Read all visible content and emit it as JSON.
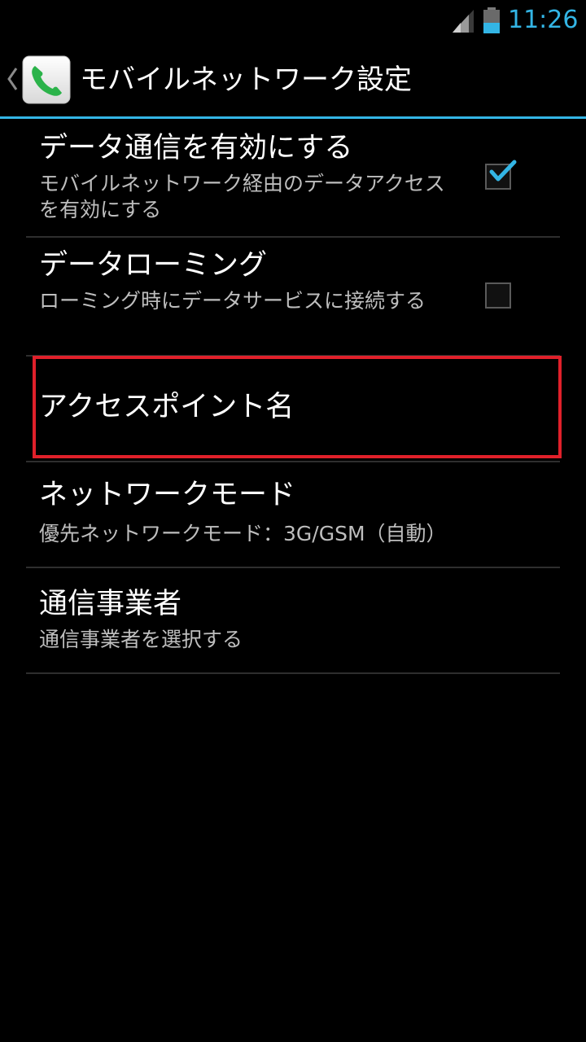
{
  "status_bar": {
    "time": "11:26",
    "signal_icon": "signal-strength-icon",
    "battery_icon": "battery-icon"
  },
  "action_bar": {
    "title": "モバイルネットワーク設定",
    "back_icon": "chevron-left-icon",
    "app_icon": "phone-app-icon"
  },
  "preferences": [
    {
      "title": "データ通信を有効にする",
      "summary": "モバイルネットワーク経由のデータアクセスを有効にする",
      "checked": true
    },
    {
      "title": "データローミング",
      "summary": "ローミング時にデータサービスに接続する",
      "checked": false
    },
    {
      "title": "アクセスポイント名"
    },
    {
      "title": "ネットワークモード",
      "summary": "優先ネットワークモード：3G/GSM（自動）"
    },
    {
      "title": "通信事業者",
      "summary": "通信事業者を選択する"
    }
  ],
  "colors": {
    "accent": "#33b5e5",
    "highlight": "#e0202a",
    "background": "#000000"
  }
}
